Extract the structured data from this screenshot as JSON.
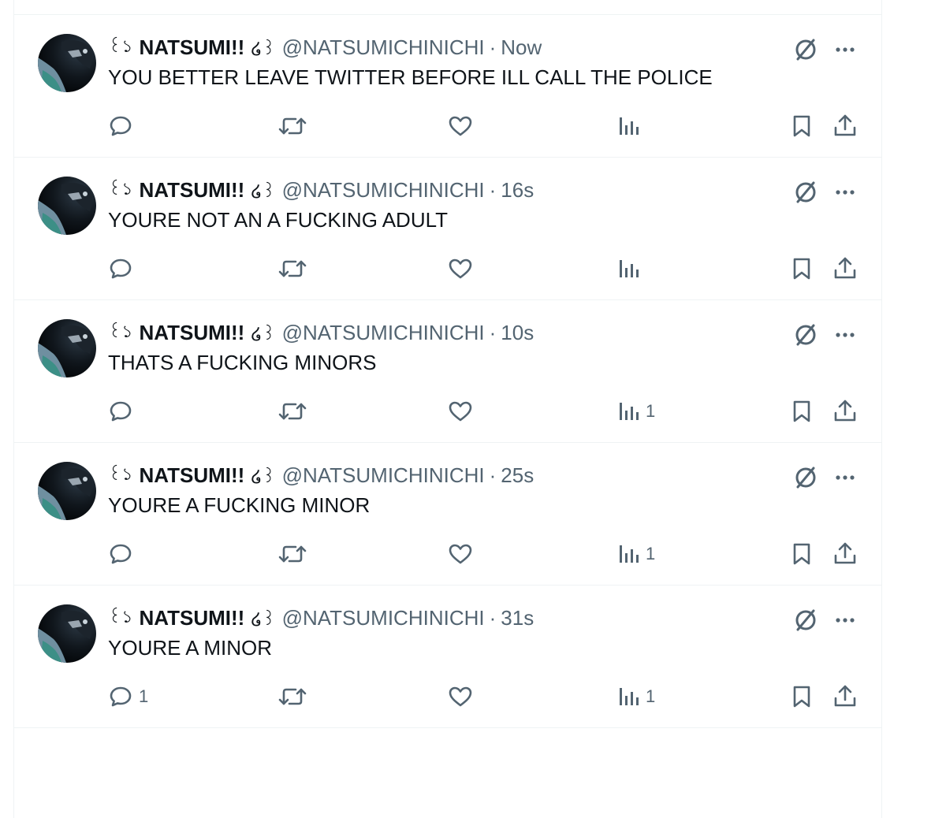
{
  "colors": {
    "text_primary": "#0f1419",
    "text_secondary": "#536471",
    "divider": "#eff3f4"
  },
  "tweets": [
    {
      "name": "NATSUMI!!",
      "prefix_glyph": "꒰১",
      "suffix_glyph": "໒꒱",
      "handle": "@NATSUMICHINICHI",
      "separator": "·",
      "time": "Now",
      "text": "YOU BETTER LEAVE TWITTER BEFORE ILL CALL THE POLICE",
      "reply_count": "",
      "views_count": ""
    },
    {
      "name": "NATSUMI!!",
      "prefix_glyph": "꒰১",
      "suffix_glyph": "໒꒱",
      "handle": "@NATSUMICHINICHI",
      "separator": "·",
      "time": "16s",
      "text": "YOURE NOT AN A FUCKING ADULT",
      "reply_count": "",
      "views_count": ""
    },
    {
      "name": "NATSUMI!!",
      "prefix_glyph": "꒰১",
      "suffix_glyph": "໒꒱",
      "handle": "@NATSUMICHINICHI",
      "separator": "·",
      "time": "10s",
      "text": "THATS A FUCKING MINORS",
      "reply_count": "",
      "views_count": "1"
    },
    {
      "name": "NATSUMI!!",
      "prefix_glyph": "꒰১",
      "suffix_glyph": "໒꒱",
      "handle": "@NATSUMICHINICHI",
      "separator": "·",
      "time": "25s",
      "text": "YOURE A FUCKING MINOR",
      "reply_count": "",
      "views_count": "1"
    },
    {
      "name": "NATSUMI!!",
      "prefix_glyph": "꒰১",
      "suffix_glyph": "໒꒱",
      "handle": "@NATSUMICHINICHI",
      "separator": "·",
      "time": "31s",
      "text": "YOURE A MINOR",
      "reply_count": "1",
      "views_count": "1"
    }
  ],
  "icons": {
    "avatar": "avatar",
    "grok": "grok-icon",
    "more": "more-icon",
    "reply": "reply-icon",
    "retweet": "retweet-icon",
    "like": "like-icon",
    "views": "views-icon",
    "bookmark": "bookmark-icon",
    "share": "share-icon"
  }
}
